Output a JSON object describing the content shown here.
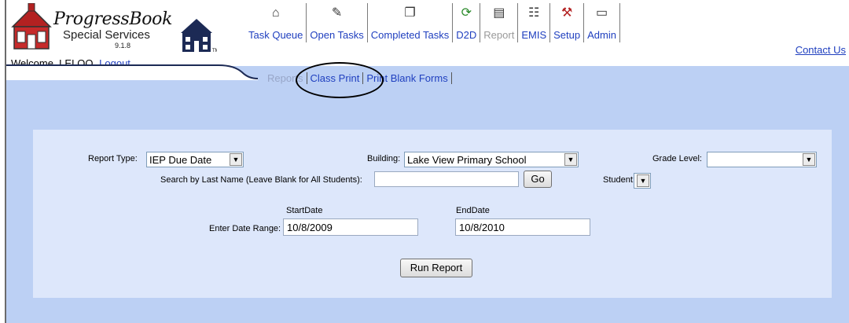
{
  "logo": {
    "title": "ProgressBook",
    "subtitle": "Special Services",
    "version": "9.1.8"
  },
  "user": {
    "welcome": "Welcome, LELOO",
    "logout": "Logout"
  },
  "topnav": [
    {
      "label": "Task Queue",
      "icon": "⌂"
    },
    {
      "label": "Open Tasks",
      "icon": "✎"
    },
    {
      "label": "Completed Tasks",
      "icon": "❐"
    },
    {
      "label": "D2D",
      "icon": "⟳"
    },
    {
      "label": "Report",
      "icon": "▤"
    },
    {
      "label": "EMIS",
      "icon": "☷"
    },
    {
      "label": "Setup",
      "icon": "⚒"
    },
    {
      "label": "Admin",
      "icon": "▭"
    }
  ],
  "contact": "Contact Us",
  "subnav": {
    "reports": "Reports",
    "class_print": "Class Print",
    "print_blank": "Print Blank Forms"
  },
  "form": {
    "report_type_label": "Report Type:",
    "report_type_value": "IEP Due Date",
    "building_label": "Building:",
    "building_value": "Lake View Primary School",
    "grade_label": "Grade Level:",
    "grade_value": "",
    "search_label": "Search by Last Name (Leave Blank for All Students):",
    "search_value": "",
    "go": "Go",
    "student_label": "Student:",
    "student_value": "",
    "start_label": "StartDate",
    "end_label": "EndDate",
    "date_range_label": "Enter Date Range:",
    "start_value": "10/8/2009",
    "end_value": "10/8/2010",
    "run": "Run Report"
  }
}
